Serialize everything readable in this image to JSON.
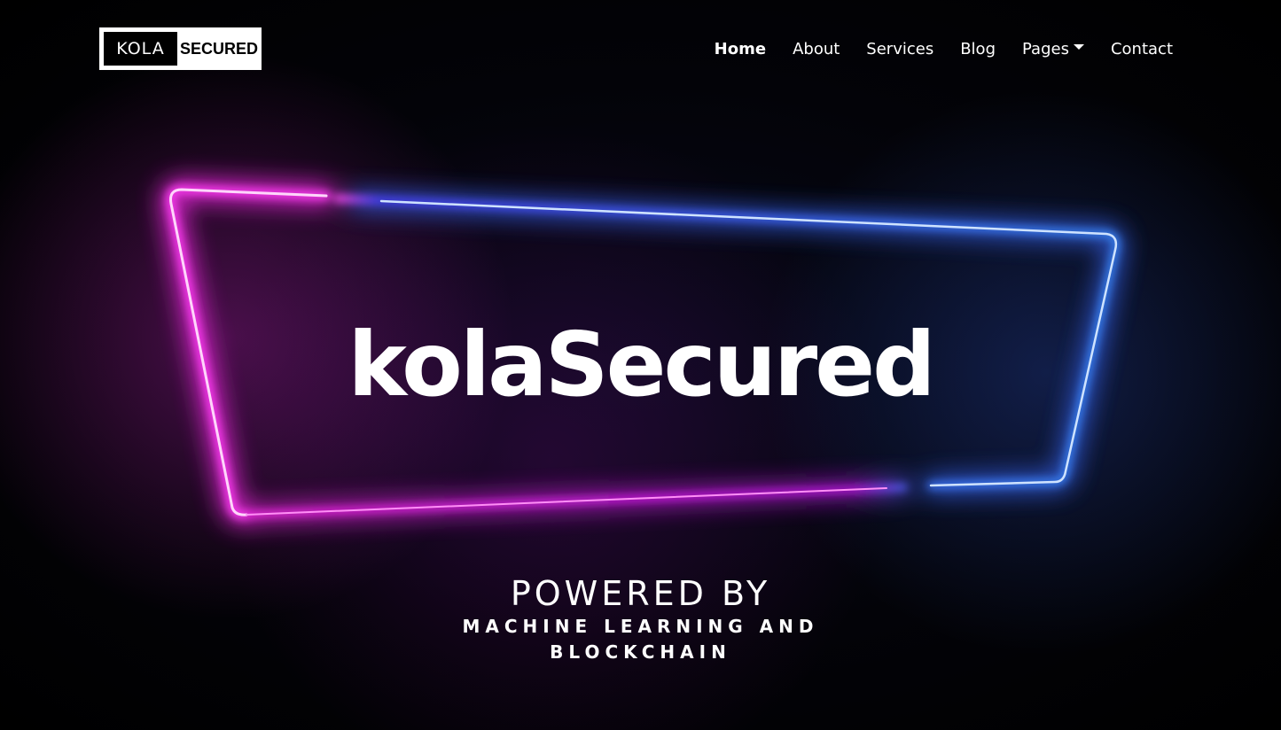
{
  "brand": {
    "logo_left": "KOLA",
    "logo_right": "SECURED"
  },
  "nav": {
    "items": [
      {
        "label": "Home",
        "active": true
      },
      {
        "label": "About"
      },
      {
        "label": "Services"
      },
      {
        "label": "Blog"
      },
      {
        "label": "Pages",
        "has_dropdown": true
      },
      {
        "label": "Contact"
      }
    ]
  },
  "hero": {
    "title": "kolaSecured",
    "powered_heading": "POWERED BY",
    "powered_sub": "MACHINE LEARNING AND BLOCKCHAIN"
  },
  "colors": {
    "neon_pink": "#ff2bf0",
    "neon_blue": "#3a8bff",
    "background": "#000000"
  }
}
